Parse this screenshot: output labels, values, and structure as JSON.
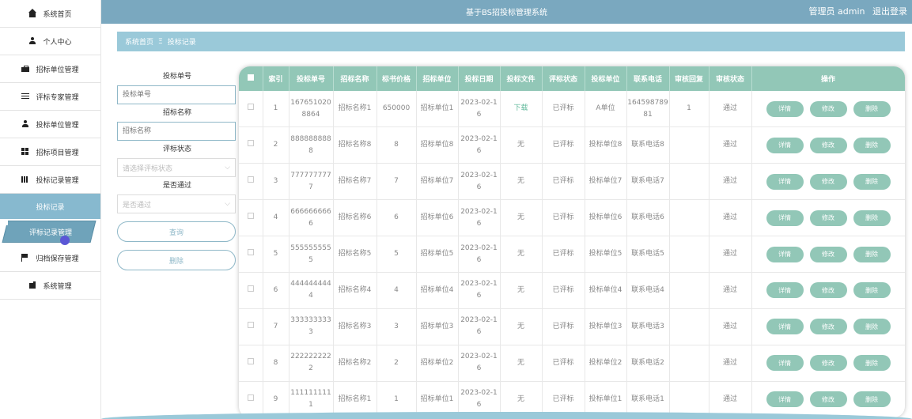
{
  "header": {
    "title": "基于BS招投标管理系统",
    "admin": "管理员 admin",
    "logout": "退出登录"
  },
  "sidebar": {
    "items": [
      {
        "label": "系统首页",
        "icon": "home-icon"
      },
      {
        "label": "个人中心",
        "icon": "user-icon"
      },
      {
        "label": "招标单位管理",
        "icon": "briefcase-icon"
      },
      {
        "label": "评标专家管理",
        "icon": "list-icon"
      },
      {
        "label": "投标单位管理",
        "icon": "user-icon"
      },
      {
        "label": "招标项目管理",
        "icon": "grid-icon"
      },
      {
        "label": "投标记录管理",
        "icon": "bars-icon"
      }
    ],
    "sub_header": "投标记录",
    "active_item": "评标记录管理",
    "after_items": [
      {
        "label": "归档保存管理",
        "icon": "flag-icon"
      },
      {
        "label": "系统管理",
        "icon": "gear-icon"
      }
    ]
  },
  "breadcrumb": {
    "home": "系统首页",
    "separator": "Ξ",
    "current": "投标记录"
  },
  "search": {
    "bid_no_label": "投标单号",
    "bid_no_placeholder": "投标单号",
    "bid_name_label": "招标名称",
    "bid_name_placeholder": "招标名称",
    "eval_status_label": "评标状态",
    "eval_status_placeholder": "请选择评标状态",
    "passed_label": "是否通过",
    "passed_placeholder": "是否通过",
    "query_button": "查询",
    "delete_button": "删除"
  },
  "table": {
    "columns": [
      "",
      "索引",
      "投标单号",
      "招标名称",
      "标书价格",
      "招标单位",
      "投标日期",
      "投标文件",
      "评标状态",
      "投标单位",
      "联系电话",
      "审核回复",
      "审核状态",
      "操作"
    ],
    "rows": [
      [
        "1",
        "1676510208864",
        "招标名称1",
        "650000",
        "招标单位1",
        "2023-02-16",
        "下载",
        "已评标",
        "A单位",
        "16459878981",
        "1",
        "通过"
      ],
      [
        "2",
        "8888888888",
        "招标名称8",
        "8",
        "招标单位8",
        "2023-02-16",
        "无",
        "已评标",
        "投标单位8",
        "联系电话8",
        "",
        "通过"
      ],
      [
        "3",
        "7777777777",
        "招标名称7",
        "7",
        "招标单位7",
        "2023-02-16",
        "无",
        "已评标",
        "投标单位7",
        "联系电话7",
        "",
        "通过"
      ],
      [
        "4",
        "6666666666",
        "招标名称6",
        "6",
        "招标单位6",
        "2023-02-16",
        "无",
        "已评标",
        "投标单位6",
        "联系电话6",
        "",
        "通过"
      ],
      [
        "5",
        "5555555555",
        "招标名称5",
        "5",
        "招标单位5",
        "2023-02-16",
        "无",
        "已评标",
        "投标单位5",
        "联系电话5",
        "",
        "通过"
      ],
      [
        "6",
        "4444444444",
        "招标名称4",
        "4",
        "招标单位4",
        "2023-02-16",
        "无",
        "已评标",
        "投标单位4",
        "联系电话4",
        "",
        "通过"
      ],
      [
        "7",
        "3333333333",
        "招标名称3",
        "3",
        "招标单位3",
        "2023-02-16",
        "无",
        "已评标",
        "投标单位3",
        "联系电话3",
        "",
        "通过"
      ],
      [
        "8",
        "2222222222",
        "招标名称2",
        "2",
        "招标单位2",
        "2023-02-16",
        "无",
        "已评标",
        "投标单位2",
        "联系电话2",
        "",
        "通过"
      ],
      [
        "9",
        "1111111111",
        "招标名称1",
        "1",
        "招标单位1",
        "2023-02-16",
        "无",
        "已评标",
        "投标单位1",
        "联系电话1",
        "",
        "通过"
      ]
    ],
    "actions": {
      "detail": "详情",
      "edit": "修改",
      "delete": "删除"
    }
  },
  "colors": {
    "header": "#7aa8bf",
    "breadcrumb": "#9ac9d9",
    "table_header": "#92c7b7",
    "sidebar_active": "#6fa3ba"
  }
}
